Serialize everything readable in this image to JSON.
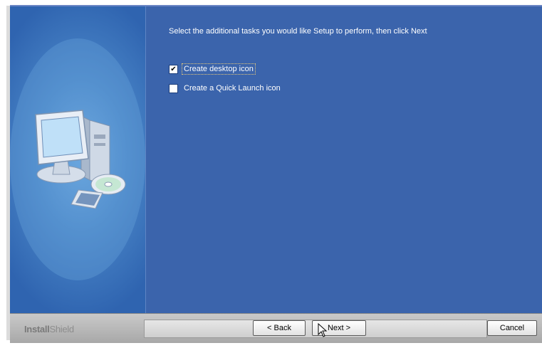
{
  "wizard": {
    "instruction": "Select the additional tasks you would like Setup to perform, then click Next",
    "options": [
      {
        "label": "Create desktop icon",
        "checked": true
      },
      {
        "label": "Create a Quick Launch icon",
        "checked": false
      }
    ]
  },
  "footer": {
    "brand_main": "Install",
    "brand_sub": "Shield",
    "back_label": "< Back",
    "next_label": "Next >",
    "cancel_label": "Cancel"
  },
  "colors": {
    "main_panel": "#3b64ac",
    "side_panel": "#4a86c8",
    "footer": "#b8b8b8"
  },
  "icons": [
    "computer-cd-illustration",
    "checkbox-checked-icon",
    "checkbox-unchecked-icon",
    "mouse-cursor-icon"
  ]
}
